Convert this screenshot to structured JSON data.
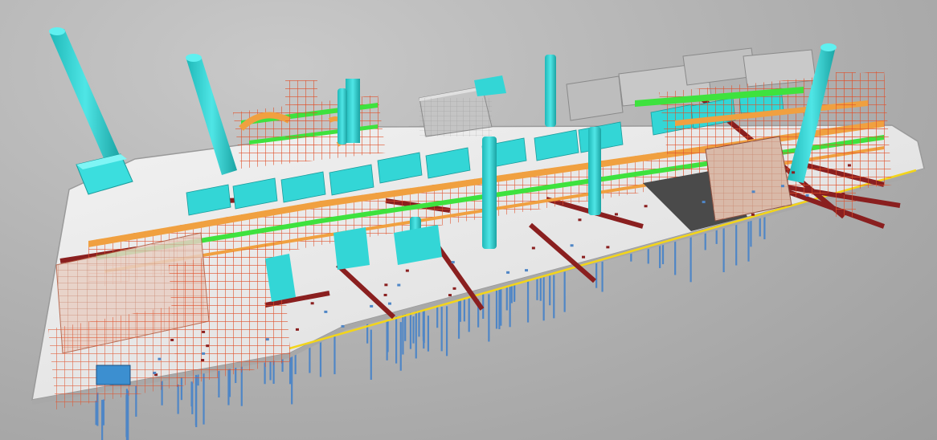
{
  "scene": {
    "colors": {
      "background": "#b5b5b5",
      "slab": "#e8e8e8",
      "slab_edge": "#9a9a9a",
      "equipment": "#33d6d6",
      "steel": "#e0502a",
      "pipe_orange": "#f0a040",
      "pipe_green": "#3ee23e",
      "support_red": "#8a1f1f",
      "piles": "#4f86c6",
      "building": "#bdbdbd",
      "cladding": "#d8a58a"
    },
    "icons": [
      "model-view-icon"
    ]
  }
}
